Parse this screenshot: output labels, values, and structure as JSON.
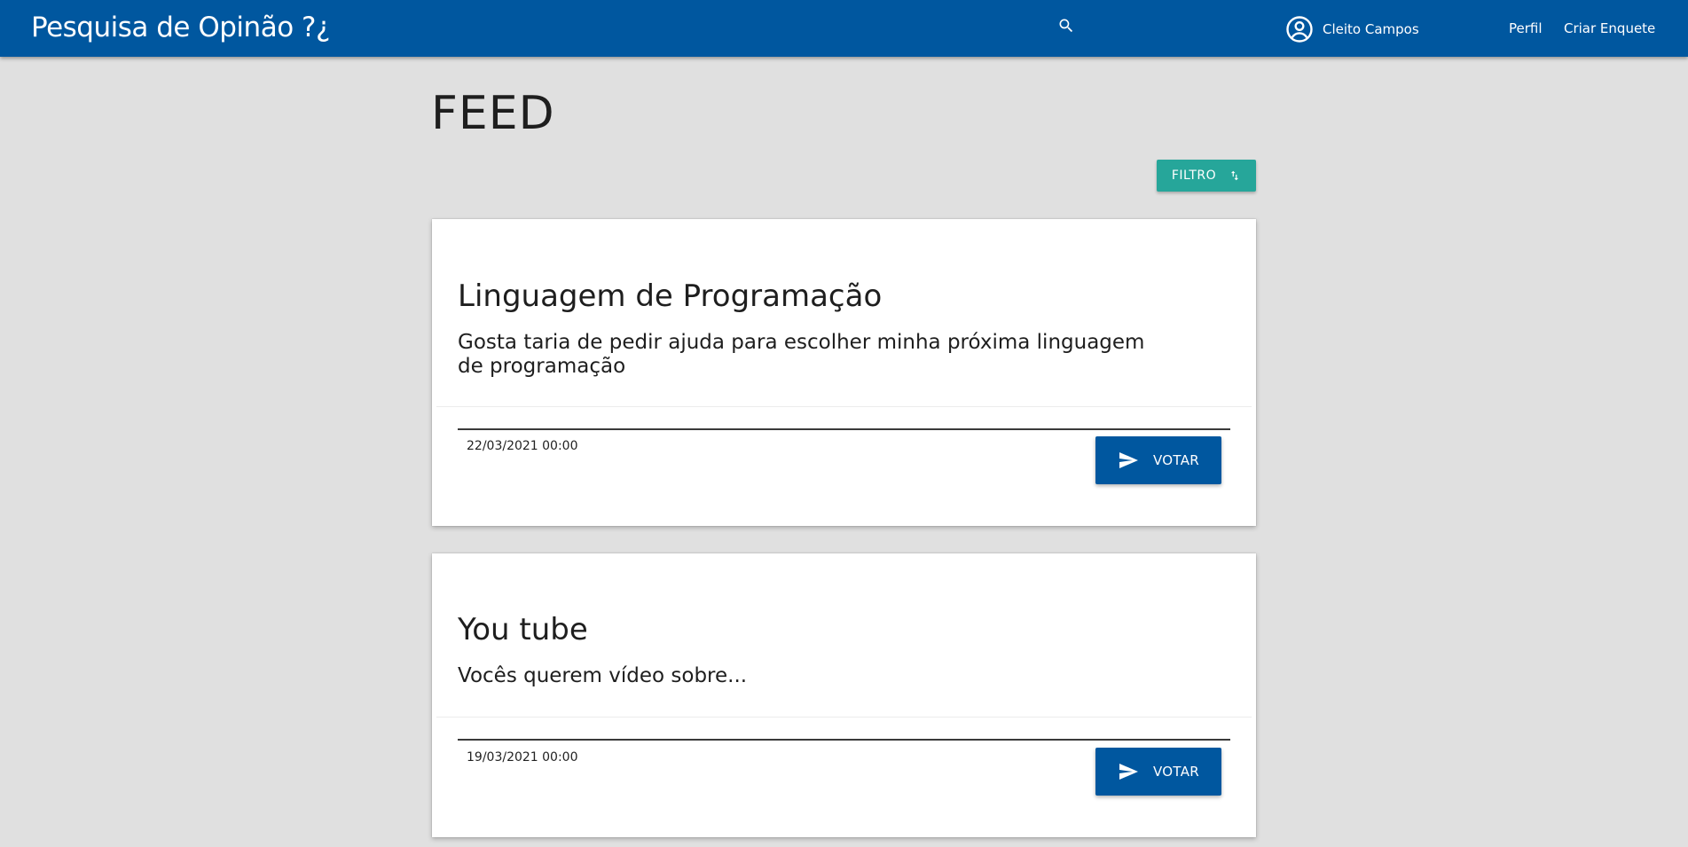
{
  "header": {
    "app_title": "Pesquisa de Opinão ?¿",
    "user_name": "Cleito Campos",
    "nav": {
      "perfil": "Perfil",
      "criar_enquete": "Criar Enquete"
    },
    "icons": {
      "search": "search-icon",
      "user": "account-circle-icon"
    }
  },
  "main": {
    "page_title": "FEED",
    "filter_label": "FILTRO",
    "filter_icon": "sort-icon"
  },
  "polls": [
    {
      "title": "Linguagem de Programação",
      "description": "Gosta taria de pedir ajuda para escolher minha próxima linguagem de programação",
      "date": "22/03/2021 00:00",
      "vote_label": "VOTAR"
    },
    {
      "title": "You tube",
      "description": "Vocês querem vídeo sobre...",
      "date": "19/03/2021 00:00",
      "vote_label": "VOTAR"
    }
  ],
  "colors": {
    "primary": "#00579f",
    "accent": "#26a69a",
    "background": "#e0e0e0"
  }
}
